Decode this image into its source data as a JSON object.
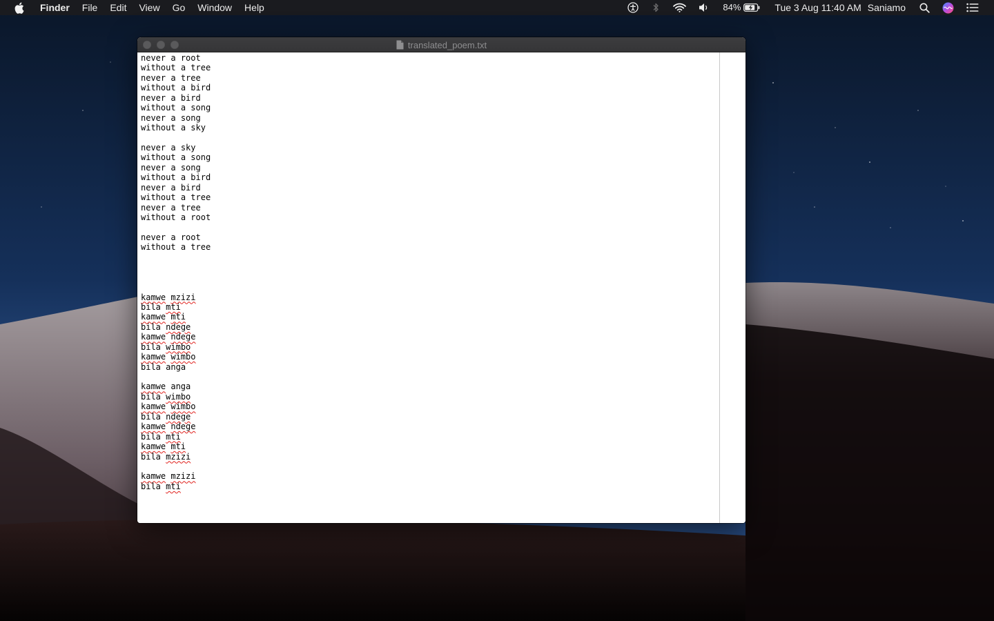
{
  "menubar": {
    "apple_icon": "apple-icon",
    "app_name": "Finder",
    "menus": [
      "File",
      "Edit",
      "View",
      "Go",
      "Window",
      "Help"
    ],
    "status": {
      "accessibility_icon": "accessibility-icon",
      "bluetooth_icon": "bluetooth-icon",
      "wifi_icon": "wifi-icon",
      "volume_icon": "volume-icon",
      "battery_percent": "84%",
      "battery_icon": "battery-charging-icon",
      "datetime": "Tue 3 Aug  11:40 AM",
      "user": "Saniamo",
      "spotlight_icon": "search-icon",
      "siri_icon": "siri-icon",
      "notification_icon": "notification-center-icon"
    }
  },
  "window": {
    "title": "translated_poem.txt",
    "title_icon": "document-icon",
    "text_color": "#000000",
    "spellcheck_color": "#e0201b",
    "lines": [
      {
        "text": "never a root"
      },
      {
        "text": "without a tree"
      },
      {
        "text": "never a tree"
      },
      {
        "text": "without a bird"
      },
      {
        "text": "never a bird"
      },
      {
        "text": "without a song"
      },
      {
        "text": "never a song"
      },
      {
        "text": "without a sky"
      },
      {
        "text": ""
      },
      {
        "text": "never a sky"
      },
      {
        "text": "without a song"
      },
      {
        "text": "never a song"
      },
      {
        "text": "without a bird"
      },
      {
        "text": "never a bird"
      },
      {
        "text": "without a tree"
      },
      {
        "text": "never a tree"
      },
      {
        "text": "without a root"
      },
      {
        "text": ""
      },
      {
        "text": "never a root"
      },
      {
        "text": "without a tree"
      },
      {
        "text": ""
      },
      {
        "text": ""
      },
      {
        "text": ""
      },
      {
        "text": ""
      },
      {
        "text": "kamwe mzizi",
        "misspelled": [
          "kamwe",
          "mzizi"
        ]
      },
      {
        "text": "bila mti",
        "misspelled": [
          "mti"
        ]
      },
      {
        "text": "kamwe mti",
        "misspelled": [
          "kamwe",
          "mti"
        ]
      },
      {
        "text": "bila ndege",
        "misspelled": [
          "ndege"
        ]
      },
      {
        "text": "kamwe ndege",
        "misspelled": [
          "kamwe",
          "ndege"
        ]
      },
      {
        "text": "bila wimbo",
        "misspelled": [
          "wimbo"
        ]
      },
      {
        "text": "kamwe wimbo",
        "misspelled": [
          "kamwe",
          "wimbo"
        ]
      },
      {
        "text": "bila anga"
      },
      {
        "text": ""
      },
      {
        "text": "kamwe anga",
        "misspelled": [
          "kamwe"
        ]
      },
      {
        "text": "bila wimbo",
        "misspelled": [
          "wimbo"
        ]
      },
      {
        "text": "kamwe wimbo",
        "misspelled": [
          "kamwe",
          "wimbo"
        ]
      },
      {
        "text": "bila ndege",
        "misspelled": [
          "ndege"
        ]
      },
      {
        "text": "kamwe ndege",
        "misspelled": [
          "kamwe",
          "ndege"
        ]
      },
      {
        "text": "bila mti",
        "misspelled": [
          "mti"
        ]
      },
      {
        "text": "kamwe mti",
        "misspelled": [
          "kamwe",
          "mti"
        ]
      },
      {
        "text": "bila mzizi",
        "misspelled": [
          "mzizi"
        ]
      },
      {
        "text": ""
      },
      {
        "text": "kamwe mzizi",
        "misspelled": [
          "kamwe",
          "mzizi"
        ]
      },
      {
        "text": "bila mti",
        "misspelled": [
          "mti"
        ]
      }
    ]
  }
}
